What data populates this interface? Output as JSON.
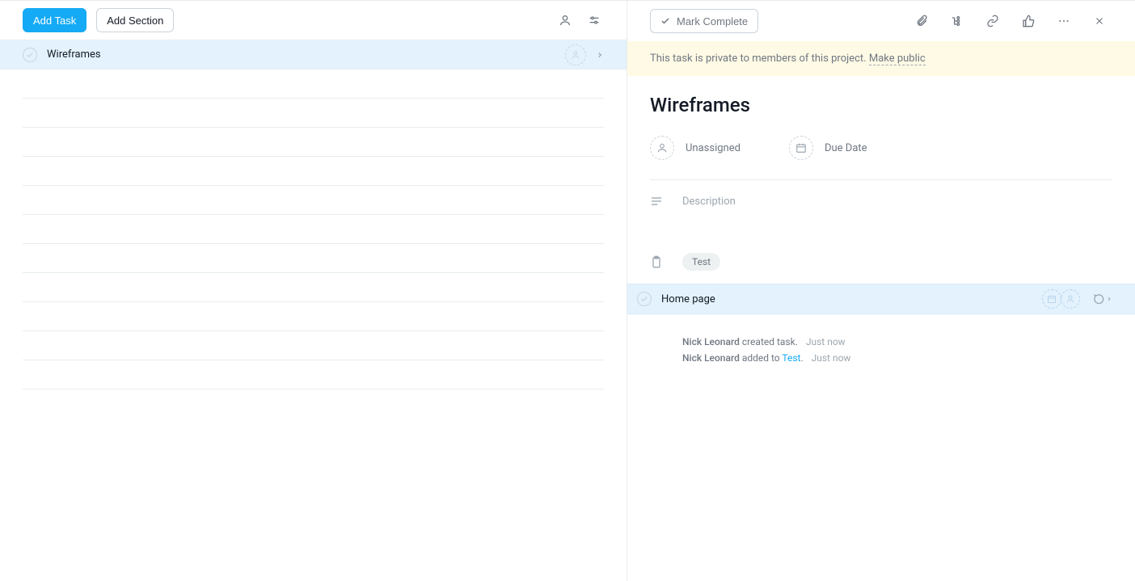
{
  "left": {
    "add_task": "Add Task",
    "add_section": "Add Section",
    "task_name": "Wireframes"
  },
  "right": {
    "mark_complete": "Mark Complete",
    "privacy_text": "This task is private to members of this project. ",
    "make_public": "Make public",
    "title": "Wireframes",
    "assignee_label": "Unassigned",
    "due_label": "Due Date",
    "description_placeholder": "Description",
    "tag": "Test",
    "subtask": "Home page",
    "activity": [
      {
        "actor": "Nick Leonard",
        "action": " created task.",
        "project": "",
        "time": "Just now"
      },
      {
        "actor": "Nick Leonard",
        "action": " added to ",
        "project": "Test",
        "suffix": ".",
        "time": "Just now"
      }
    ]
  }
}
